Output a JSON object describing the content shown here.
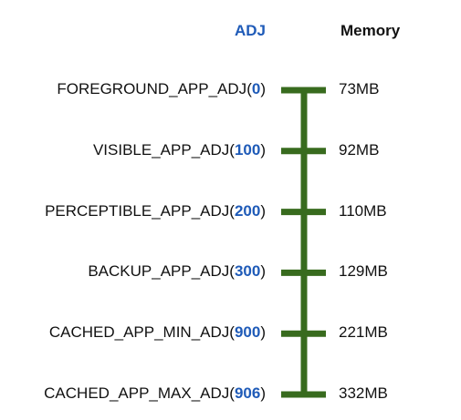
{
  "headers": {
    "adj": "ADJ",
    "memory": "Memory"
  },
  "colors": {
    "accent_blue": "#1f5bb8",
    "bar_green": "#386b1e",
    "text": "#111111"
  },
  "rows": [
    {
      "name": "FOREGROUND_APP_ADJ",
      "value": "0",
      "memory": "73MB"
    },
    {
      "name": "VISIBLE_APP_ADJ",
      "value": "100",
      "memory": "92MB"
    },
    {
      "name": "PERCEPTIBLE_APP_ADJ",
      "value": "200",
      "memory": "110MB"
    },
    {
      "name": "BACKUP_APP_ADJ",
      "value": "300",
      "memory": "129MB"
    },
    {
      "name": "CACHED_APP_MIN_ADJ",
      "value": "900",
      "memory": "221MB"
    },
    {
      "name": "CACHED_APP_MAX_ADJ",
      "value": "906",
      "memory": "332MB"
    }
  ]
}
